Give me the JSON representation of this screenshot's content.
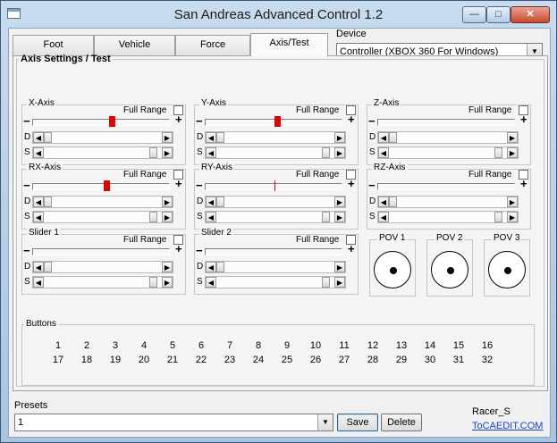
{
  "window": {
    "title": "San Andreas Advanced Control 1.2",
    "controls": {
      "minimize": "—",
      "maximize": "□",
      "close": "✕"
    }
  },
  "tabs": [
    {
      "label": "Foot"
    },
    {
      "label": "Vehicle"
    },
    {
      "label": "Force"
    },
    {
      "label": "Axis/Test",
      "active": true
    }
  ],
  "device": {
    "label": "Device",
    "value": "Controller (XBOX 360 For Windows)"
  },
  "axis_panel": {
    "title": "Axis Settings / Test",
    "full_range_label": "Full Range",
    "minus": "−",
    "plus": "+",
    "d_label": "D",
    "s_label": "S",
    "axes": [
      {
        "name": "X-Axis",
        "level": 0.55
      },
      {
        "name": "Y-Axis",
        "level": 0.5
      },
      {
        "name": "Z-Axis",
        "level": null
      },
      {
        "name": "RX-Axis",
        "level": 0.51
      },
      {
        "name": "RY-Axis",
        "level": 0.5
      },
      {
        "name": "RZ-Axis",
        "level": null
      },
      {
        "name": "Slider 1",
        "level": null
      },
      {
        "name": "Slider 2",
        "level": null
      }
    ],
    "povs": [
      {
        "name": "POV 1"
      },
      {
        "name": "POV 2"
      },
      {
        "name": "POV 3"
      }
    ]
  },
  "buttons_panel": {
    "title": "Buttons",
    "row1": [
      "1",
      "2",
      "3",
      "4",
      "5",
      "6",
      "7",
      "8",
      "9",
      "10",
      "11",
      "12",
      "13",
      "14",
      "15",
      "16"
    ],
    "row2": [
      "17",
      "18",
      "19",
      "20",
      "21",
      "22",
      "23",
      "24",
      "25",
      "26",
      "27",
      "28",
      "29",
      "30",
      "31",
      "32"
    ]
  },
  "presets": {
    "label": "Presets",
    "value": "1",
    "save_label": "Save",
    "delete_label": "Delete"
  },
  "footer": {
    "author": "Racer_S",
    "link": "ToCAEDIT.COM"
  },
  "icons": {
    "app": "app-window-icon",
    "dropdown": "chevron-down-icon",
    "scroll_left": "arrow-left-icon",
    "scroll_right": "arrow-right-icon"
  }
}
